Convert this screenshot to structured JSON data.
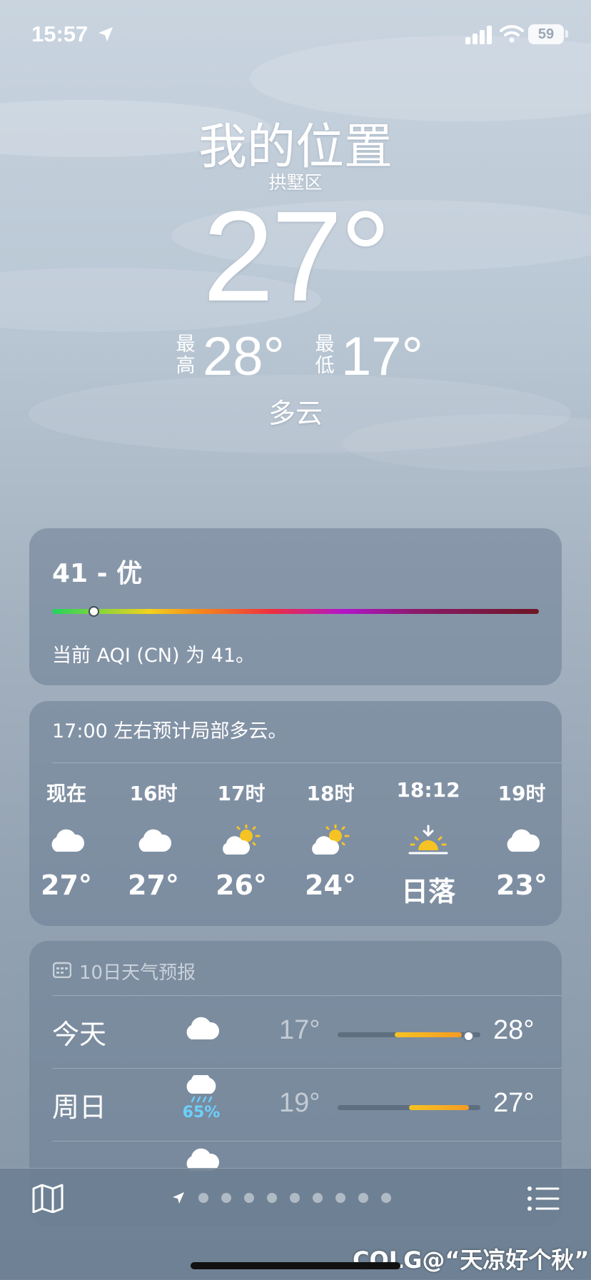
{
  "status_bar": {
    "time": "15:57",
    "battery": "59"
  },
  "location": {
    "title": "我的位置",
    "district": "拱墅区"
  },
  "current": {
    "temp": "27°",
    "high_label": "最高",
    "high": "28°",
    "low_label": "最低",
    "low": "17°",
    "condition": "多云"
  },
  "aqi": {
    "title": "41 - 优",
    "value": 41,
    "description": "当前 AQI (CN) 为 41。"
  },
  "hourly": {
    "summary": "17:00 左右预计局部多云。",
    "items": [
      {
        "label": "现在",
        "icon": "cloud-icon",
        "temp": "27°"
      },
      {
        "label": "16时",
        "icon": "cloud-icon",
        "temp": "27°"
      },
      {
        "label": "17时",
        "icon": "partly-sunny-icon",
        "temp": "26°"
      },
      {
        "label": "18时",
        "icon": "partly-sunny-icon",
        "temp": "24°"
      },
      {
        "label": "18:12",
        "icon": "sunset-icon",
        "temp": "日落"
      },
      {
        "label": "19时",
        "icon": "cloud-icon",
        "temp": "23°"
      }
    ]
  },
  "daily": {
    "header": "10日天气预报",
    "days": [
      {
        "name": "今天",
        "icon": "cloud-icon",
        "low": "17°",
        "high": "28°",
        "precip": "",
        "range_start": 0.4,
        "range_end": 0.87
      },
      {
        "name": "周日",
        "icon": "rain-cloud-icon",
        "low": "19°",
        "high": "27°",
        "precip": "65%",
        "range_start": 0.5,
        "range_end": 0.92
      }
    ]
  },
  "watermark": "COLG@“天凉好个秋”",
  "colors": {
    "sun": "#f6c324",
    "precip": "#6cd0ff",
    "aqi_good": "#21d35f"
  }
}
